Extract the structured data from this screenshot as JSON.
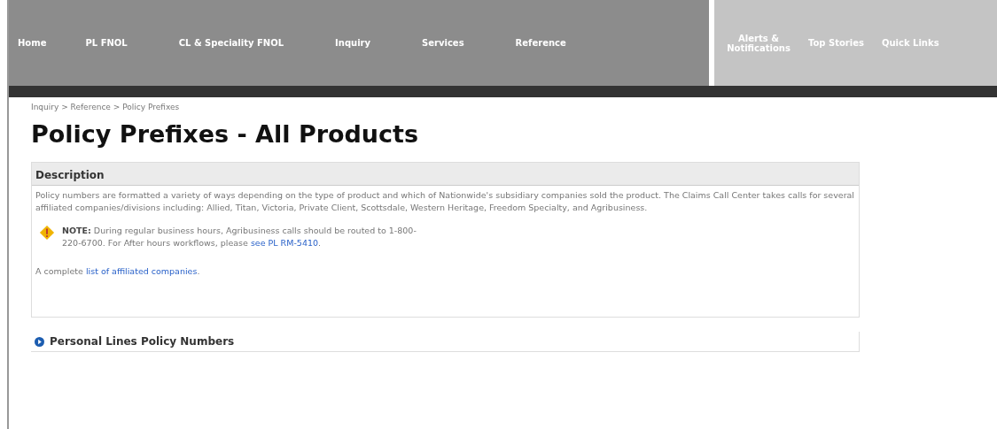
{
  "nav": {
    "items": [
      {
        "label": "Home"
      },
      {
        "label": "PL FNOL"
      },
      {
        "label": "CL & Speciality FNOL"
      },
      {
        "label": "Inquiry"
      },
      {
        "label": "Services"
      },
      {
        "label": "Reference"
      }
    ],
    "utility": [
      {
        "label": "Alerts & Notifications"
      },
      {
        "label": "Top Stories"
      },
      {
        "label": "Quick Links"
      }
    ]
  },
  "breadcrumb": "Inquiry > Reference > Policy Prefixes",
  "title": "Policy Prefixes - All Products",
  "description": {
    "heading": "Description",
    "text": "Policy numbers are formatted a variety of ways depending on the type of product and which of Nationwide's subsidiary companies sold the product. The Claims Call Center takes calls for several affiliated companies/divisions including: Allied, Titan, Victoria, Private Client, Scottsdale, Western Heritage, Freedom Specialty, and Agribusiness.",
    "note": {
      "label": "NOTE:",
      "text": "During regular business hours, Agribusiness calls should be routed to 1-800-220-6700. For After hours workflows, please ",
      "link": "see PL RM-5410",
      "end": "."
    },
    "list": {
      "text": "A complete ",
      "link": "list of affiliated companies",
      "end": "."
    }
  },
  "sections": [
    {
      "title": "Personal Lines Policy Numbers",
      "expanded": false
    }
  ]
}
